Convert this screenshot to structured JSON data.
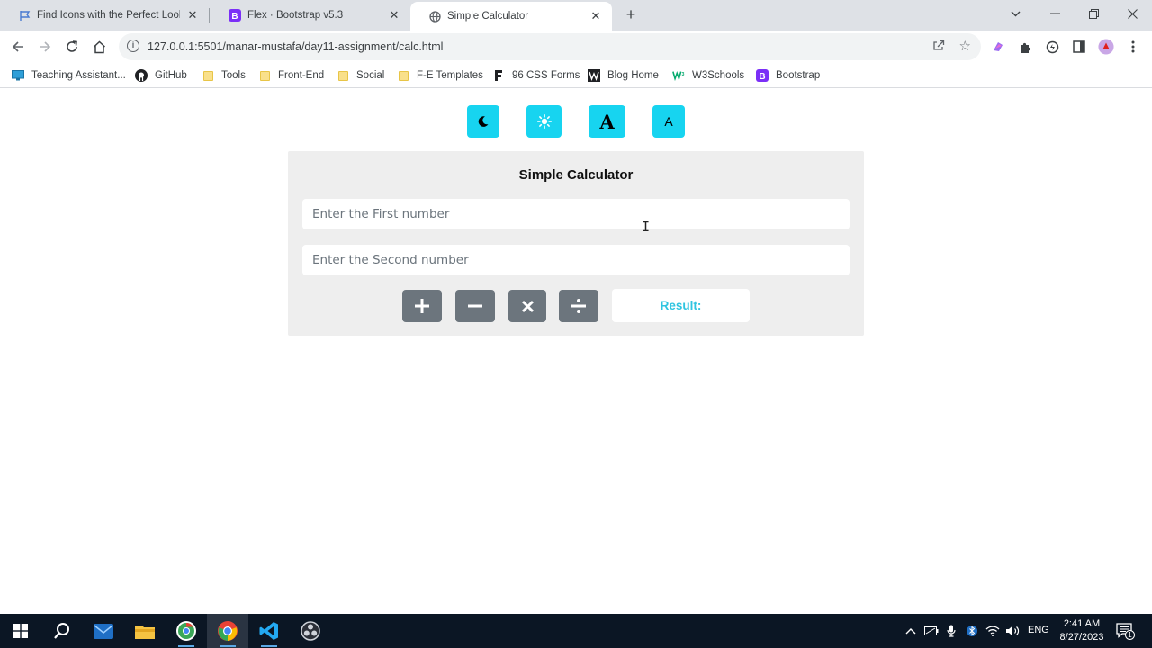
{
  "browser": {
    "tabs": [
      {
        "title": "Find Icons with the Perfect Look",
        "favicon": "flag-icon"
      },
      {
        "title": "Flex · Bootstrap v5.3",
        "favicon": "bootstrap-icon"
      },
      {
        "title": "Simple Calculator",
        "favicon": "globe-icon"
      }
    ],
    "url": "127.0.0.1:5501/manar-mustafa/day11-assignment/calc.html",
    "bookmarks": [
      {
        "label": "Teaching Assistant...",
        "icon": "monitor-icon"
      },
      {
        "label": "GitHub",
        "icon": "github-icon"
      },
      {
        "label": "Tools",
        "icon": "folder-icon"
      },
      {
        "label": "Front-End",
        "icon": "folder-icon"
      },
      {
        "label": "Social",
        "icon": "folder-icon"
      },
      {
        "label": "F-E Templates",
        "icon": "folder-icon"
      },
      {
        "label": "96 CSS Forms",
        "icon": "f-icon"
      },
      {
        "label": "Blog Home",
        "icon": "w-icon"
      },
      {
        "label": "W3Schools",
        "icon": "w3-icon"
      },
      {
        "label": "Bootstrap",
        "icon": "bootstrap-icon"
      }
    ]
  },
  "page": {
    "theme_buttons": [
      {
        "name": "dark-mode",
        "icon": "moon-icon"
      },
      {
        "name": "light-mode",
        "icon": "sun-icon"
      },
      {
        "name": "font-large",
        "label": "A"
      },
      {
        "name": "font-small",
        "label": "A"
      }
    ],
    "calculator": {
      "title": "Simple Calculator",
      "first_placeholder": "Enter the First number",
      "second_placeholder": "Enter the Second number",
      "operators": [
        "plus-icon",
        "minus-icon",
        "multiply-icon",
        "divide-icon"
      ],
      "result_label": "Result:"
    },
    "colors": {
      "accent": "#17d4f0",
      "operator": "#6c757d",
      "panel": "#eeeeee",
      "result_text": "#2fc4e0"
    }
  },
  "taskbar": {
    "language": "ENG",
    "time": "2:41 AM",
    "date": "8/27/2023",
    "notification_count": "1"
  }
}
